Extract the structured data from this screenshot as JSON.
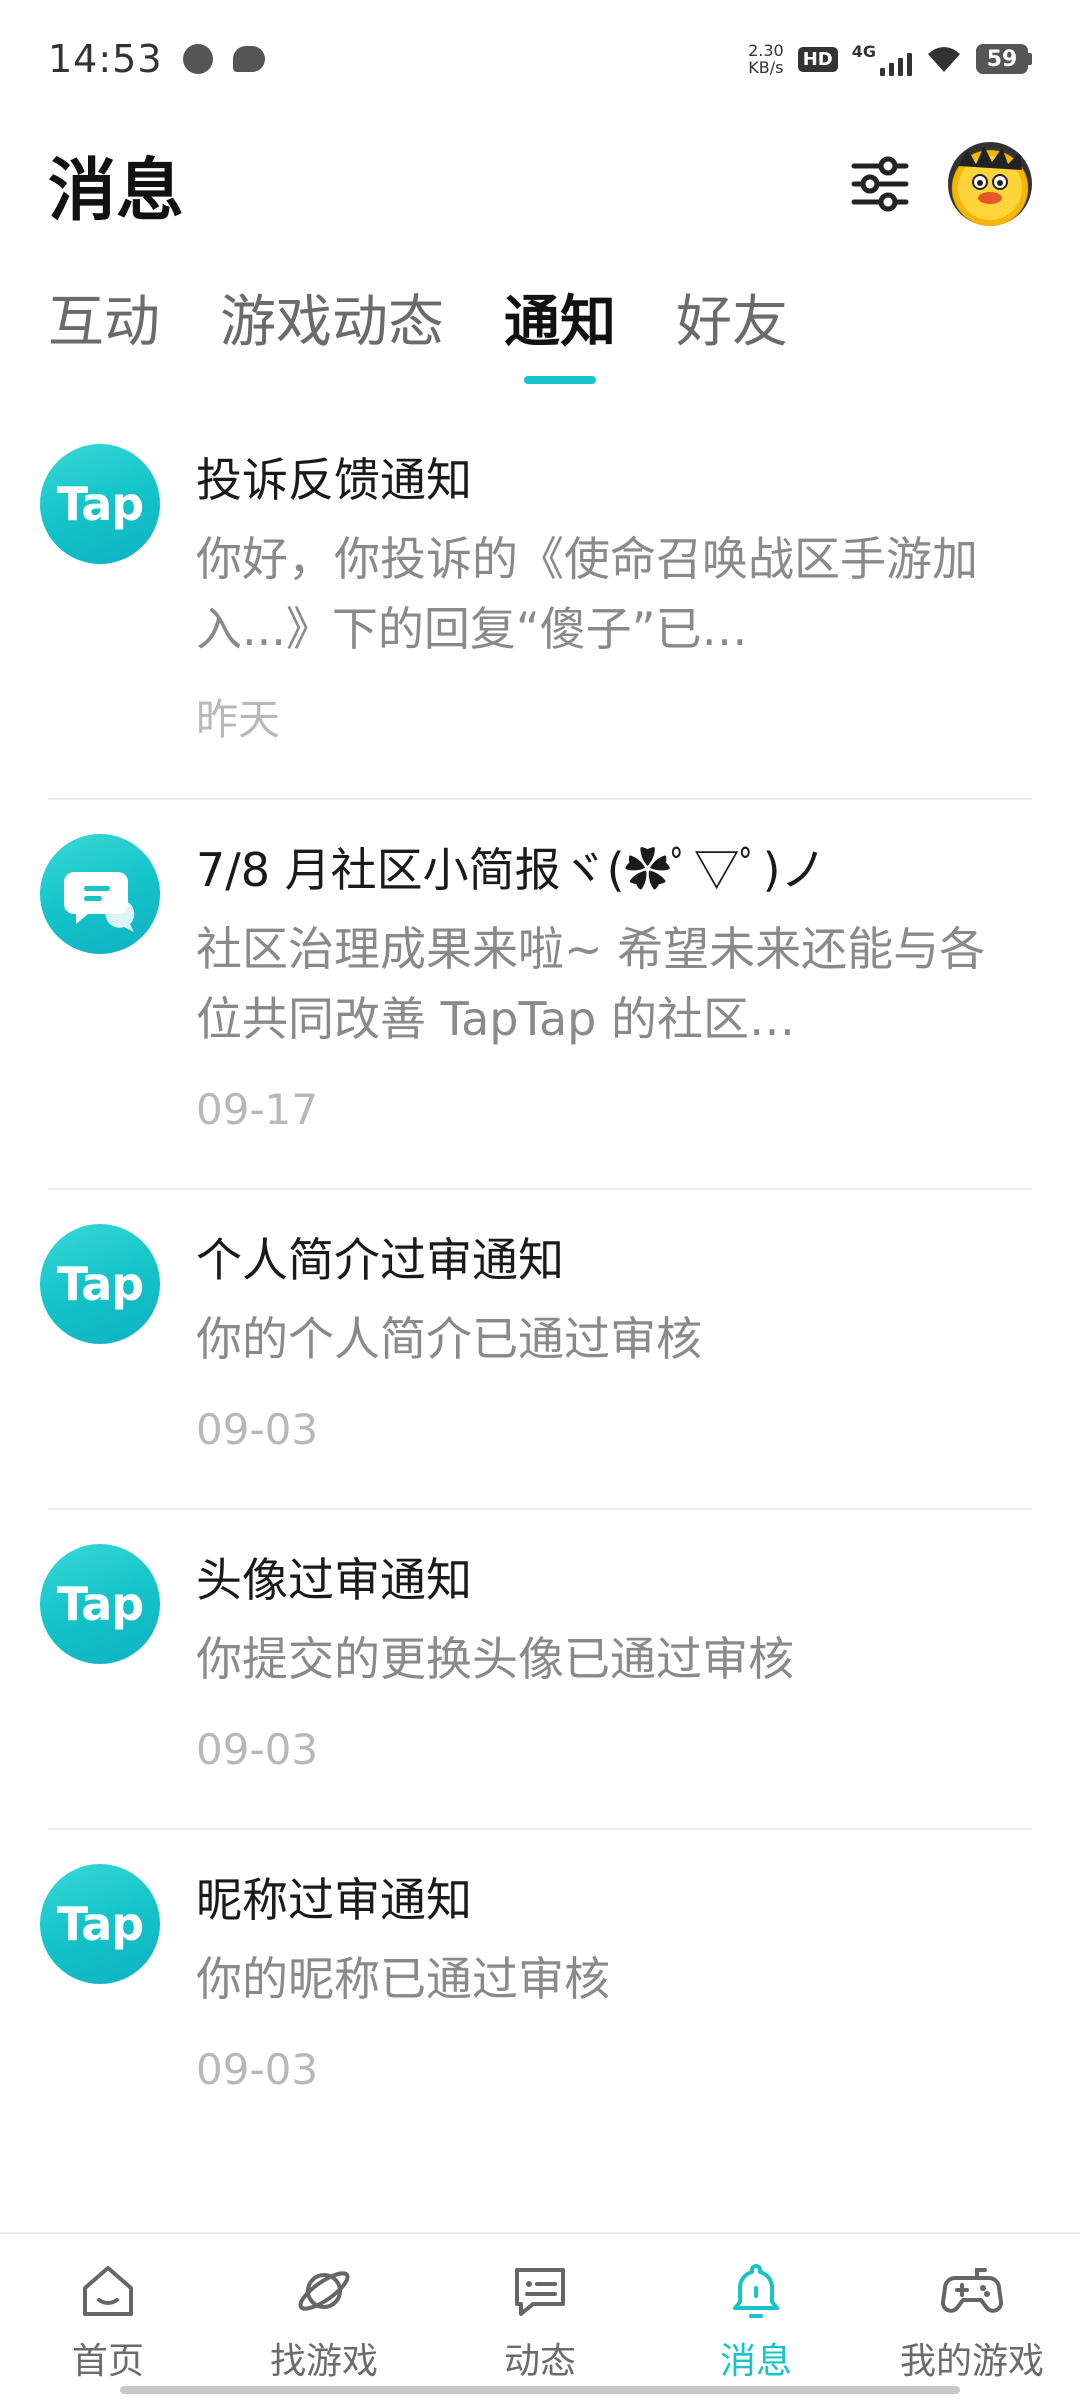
{
  "status_bar": {
    "time": "14:53",
    "net_speed_value": "2.30",
    "net_speed_unit": "KB/s",
    "hd_label": "HD",
    "signal_label": "4G",
    "battery": "59"
  },
  "header": {
    "title": "消息"
  },
  "tabs": [
    {
      "label": "互动"
    },
    {
      "label": "游戏动态"
    },
    {
      "label": "通知"
    },
    {
      "label": "好友"
    }
  ],
  "active_tab": "通知",
  "accent_color": "#14c4c9",
  "notifications": [
    {
      "icon": "tap-logo",
      "icon_text": "Tap",
      "title": "投诉反馈通知",
      "body": "你好，你投诉的《使命召唤战区手游加入...》下的回复“傻子”已…",
      "date": "昨天"
    },
    {
      "icon": "chat-bubble-icon",
      "title": "7/8 月社区小简报ヾ(✿ﾟ▽ﾟ)ノ",
      "body": "社区治理成果来啦~ 希望未来还能与各位共同改善 TapTap 的社区…",
      "date": "09-17"
    },
    {
      "icon": "tap-logo",
      "icon_text": "Tap",
      "title": "个人简介过审通知",
      "body": "你的个人简介已通过审核",
      "date": "09-03"
    },
    {
      "icon": "tap-logo",
      "icon_text": "Tap",
      "title": "头像过审通知",
      "body": "你提交的更换头像已通过审核",
      "date": "09-03"
    },
    {
      "icon": "tap-logo",
      "icon_text": "Tap",
      "title": "昵称过审通知",
      "body": "你的昵称已通过审核",
      "date": "09-03"
    }
  ],
  "bottom_nav": [
    {
      "label": "首页",
      "icon": "home-icon"
    },
    {
      "label": "找游戏",
      "icon": "planet-icon"
    },
    {
      "label": "动态",
      "icon": "feed-icon"
    },
    {
      "label": "消息",
      "icon": "bell-icon"
    },
    {
      "label": "我的游戏",
      "icon": "gamepad-icon"
    }
  ],
  "active_nav": "消息"
}
